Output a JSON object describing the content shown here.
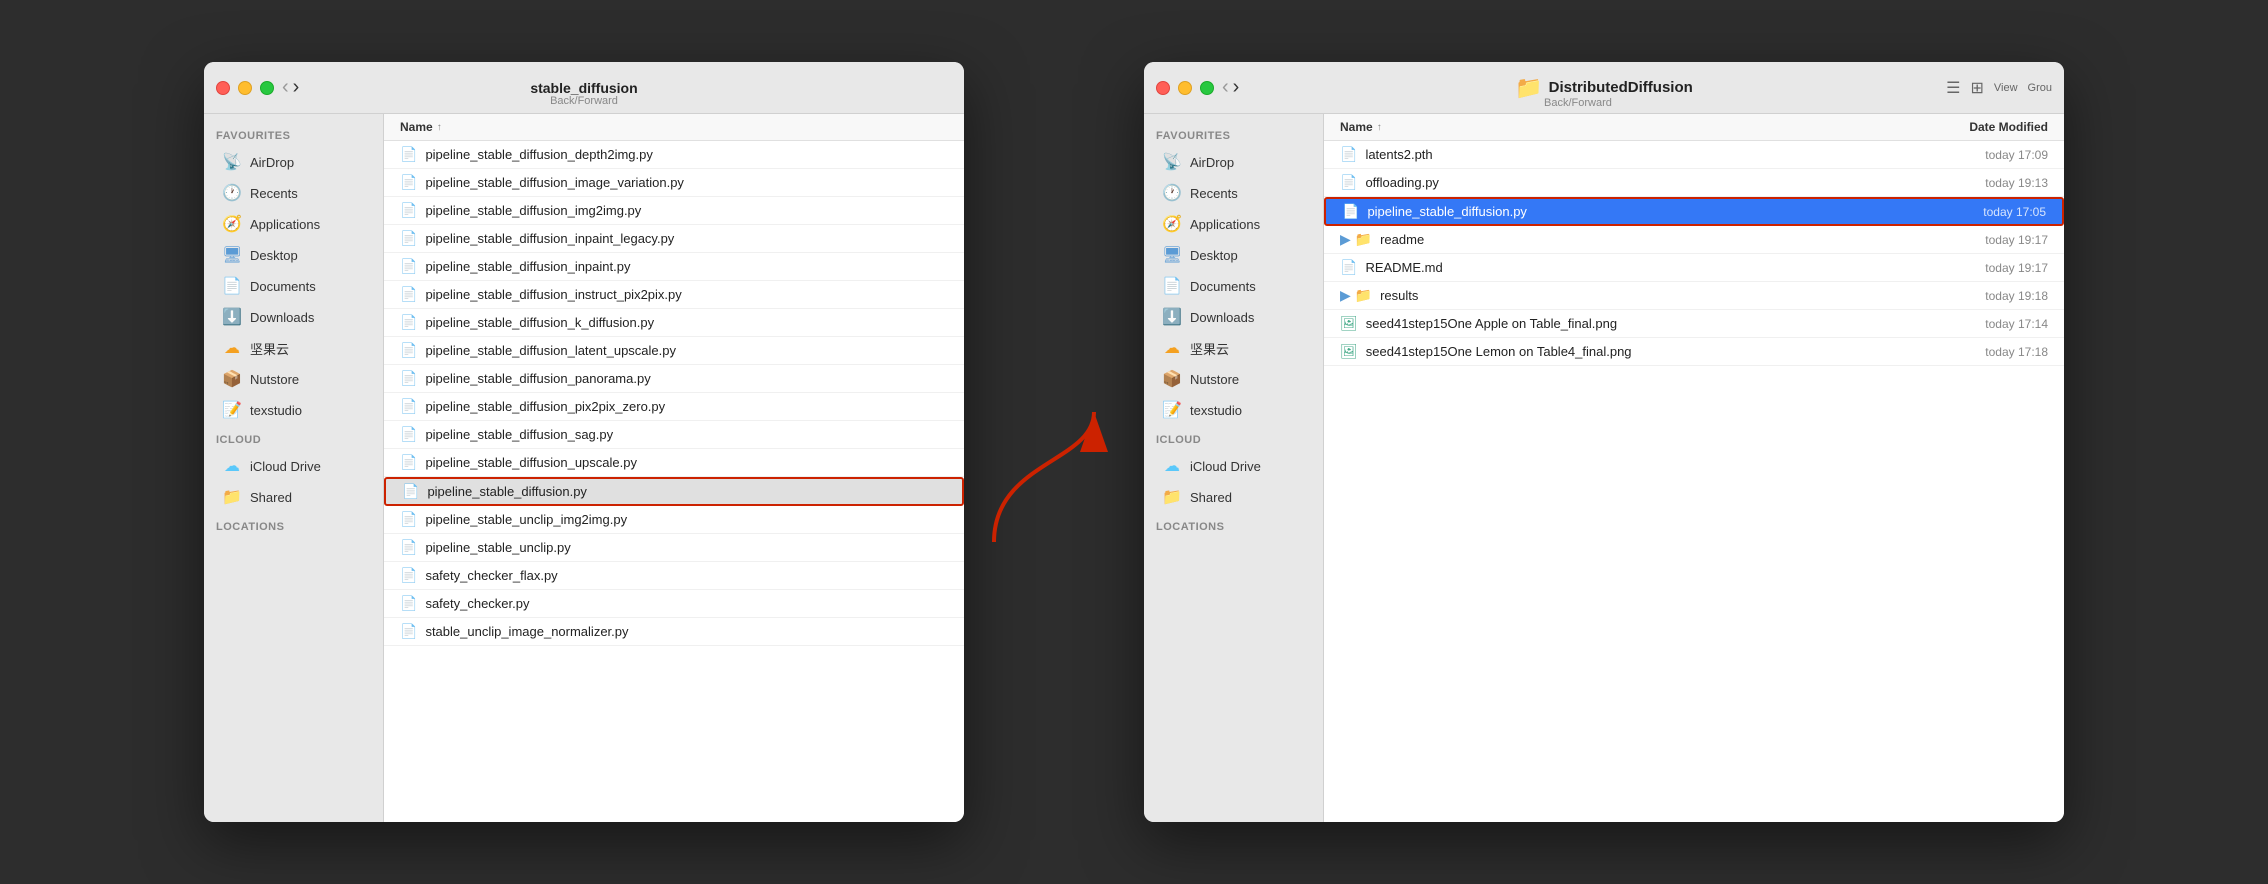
{
  "left_window": {
    "title": "stable_diffusion",
    "nav_label": "Back/Forward",
    "sidebar": {
      "favourites_label": "Favourites",
      "items_favourites": [
        {
          "id": "airdrop",
          "label": "AirDrop",
          "icon": "airdrop"
        },
        {
          "id": "recents",
          "label": "Recents",
          "icon": "recents"
        },
        {
          "id": "applications",
          "label": "Applications",
          "icon": "applications"
        },
        {
          "id": "desktop",
          "label": "Desktop",
          "icon": "desktop"
        },
        {
          "id": "documents",
          "label": "Documents",
          "icon": "documents"
        },
        {
          "id": "downloads",
          "label": "Downloads",
          "icon": "downloads"
        },
        {
          "id": "jianguo",
          "label": "坚果云",
          "icon": "jianguo"
        },
        {
          "id": "nutstore",
          "label": "Nutstore",
          "icon": "nutstore"
        },
        {
          "id": "texstudio",
          "label": "texstudio",
          "icon": "texstudio"
        }
      ],
      "icloud_label": "iCloud",
      "items_icloud": [
        {
          "id": "icloud-drive",
          "label": "iCloud Drive",
          "icon": "icloud"
        },
        {
          "id": "shared",
          "label": "Shared",
          "icon": "shared"
        }
      ]
    },
    "column_header": {
      "name_label": "Name",
      "sort_arrow": "↑"
    },
    "files": [
      {
        "name": "pipeline_stable_diffusion_depth2img.py",
        "type": "py",
        "selected": false,
        "highlighted": false
      },
      {
        "name": "pipeline_stable_diffusion_image_variation.py",
        "type": "py",
        "selected": false,
        "highlighted": false
      },
      {
        "name": "pipeline_stable_diffusion_img2img.py",
        "type": "py",
        "selected": false,
        "highlighted": false
      },
      {
        "name": "pipeline_stable_diffusion_inpaint_legacy.py",
        "type": "py",
        "selected": false,
        "highlighted": false
      },
      {
        "name": "pipeline_stable_diffusion_inpaint.py",
        "type": "py",
        "selected": false,
        "highlighted": false
      },
      {
        "name": "pipeline_stable_diffusion_instruct_pix2pix.py",
        "type": "py",
        "selected": false,
        "highlighted": false
      },
      {
        "name": "pipeline_stable_diffusion_k_diffusion.py",
        "type": "py",
        "selected": false,
        "highlighted": false
      },
      {
        "name": "pipeline_stable_diffusion_latent_upscale.py",
        "type": "py",
        "selected": false,
        "highlighted": false
      },
      {
        "name": "pipeline_stable_diffusion_panorama.py",
        "type": "py",
        "selected": false,
        "highlighted": false
      },
      {
        "name": "pipeline_stable_diffusion_pix2pix_zero.py",
        "type": "py",
        "selected": false,
        "highlighted": false
      },
      {
        "name": "pipeline_stable_diffusion_sag.py",
        "type": "py",
        "selected": false,
        "highlighted": false
      },
      {
        "name": "pipeline_stable_diffusion_upscale.py",
        "type": "py",
        "selected": false,
        "highlighted": false
      },
      {
        "name": "pipeline_stable_diffusion.py",
        "type": "py",
        "selected": false,
        "highlighted": true
      },
      {
        "name": "pipeline_stable_unclip_img2img.py",
        "type": "py",
        "selected": false,
        "highlighted": false
      },
      {
        "name": "pipeline_stable_unclip.py",
        "type": "py",
        "selected": false,
        "highlighted": false
      },
      {
        "name": "safety_checker_flax.py",
        "type": "py",
        "selected": false,
        "highlighted": false
      },
      {
        "name": "safety_checker.py",
        "type": "py",
        "selected": false,
        "highlighted": false
      },
      {
        "name": "stable_unclip_image_normalizer.py",
        "type": "py",
        "selected": false,
        "highlighted": false
      }
    ]
  },
  "right_window": {
    "title": "DistributedDiffusion",
    "nav_label": "Back/Forward",
    "title_icon": "📁",
    "sidebar": {
      "favourites_label": "Favourites",
      "items_favourites": [
        {
          "id": "airdrop",
          "label": "AirDrop",
          "icon": "airdrop"
        },
        {
          "id": "recents",
          "label": "Recents",
          "icon": "recents"
        },
        {
          "id": "applications",
          "label": "Applications",
          "icon": "applications"
        },
        {
          "id": "desktop",
          "label": "Desktop",
          "icon": "desktop"
        },
        {
          "id": "documents",
          "label": "Documents",
          "icon": "documents"
        },
        {
          "id": "downloads",
          "label": "Downloads",
          "icon": "downloads"
        },
        {
          "id": "jianguo",
          "label": "坚果云",
          "icon": "jianguo"
        },
        {
          "id": "nutstore",
          "label": "Nutstore",
          "icon": "nutstore"
        },
        {
          "id": "texstudio",
          "label": "texstudio",
          "icon": "texstudio"
        }
      ],
      "icloud_label": "iCloud",
      "items_icloud": [
        {
          "id": "icloud-drive",
          "label": "iCloud Drive",
          "icon": "icloud"
        },
        {
          "id": "shared",
          "label": "Shared",
          "icon": "shared"
        }
      ],
      "locations_label": "Locations"
    },
    "column_header": {
      "name_label": "Name",
      "sort_arrow": "↑",
      "date_label": "Date Modified"
    },
    "files": [
      {
        "name": "latents2.pth",
        "type": "file",
        "date": "today 17:09",
        "selected": false,
        "folder": false
      },
      {
        "name": "offloading.py",
        "type": "py",
        "date": "today 19:13",
        "selected": false,
        "folder": false
      },
      {
        "name": "pipeline_stable_diffusion.py",
        "type": "py",
        "date": "today 17:05",
        "selected": true,
        "folder": false
      },
      {
        "name": "readme",
        "type": "folder",
        "date": "today 19:17",
        "selected": false,
        "folder": true
      },
      {
        "name": "README.md",
        "type": "md",
        "date": "today 19:17",
        "selected": false,
        "folder": false
      },
      {
        "name": "results",
        "type": "folder",
        "date": "today 19:18",
        "selected": false,
        "folder": true
      },
      {
        "name": "seed41step15One Apple on Table_final.png",
        "type": "png",
        "date": "today 17:14",
        "selected": false,
        "folder": false
      },
      {
        "name": "seed41step15One Lemon on Table4_final.png",
        "type": "png",
        "date": "today 17:18",
        "selected": false,
        "folder": false
      }
    ],
    "toolbar": {
      "view_label": "View",
      "group_label": "Grou"
    }
  },
  "arrow": {
    "description": "Red arrow from left window highlighted file to right window selected file"
  }
}
